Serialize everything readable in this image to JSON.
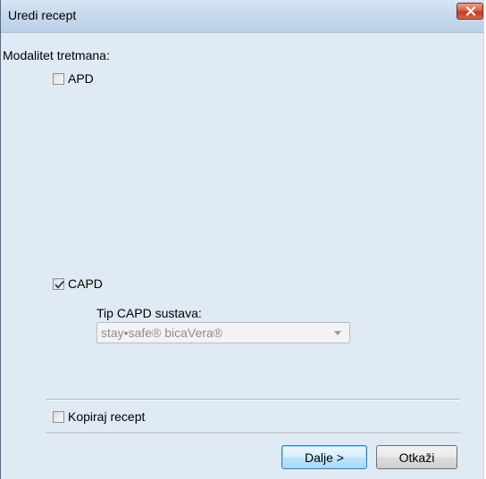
{
  "window": {
    "title": "Uredi recept"
  },
  "treatment": {
    "group_label": "Modalitet tretmana:",
    "apd": {
      "label": "APD",
      "checked": false
    },
    "capd": {
      "label": "CAPD",
      "checked": true,
      "system_type_label": "Tip CAPD sustava:",
      "system_type_value": "stay•safe® bicaVera®"
    }
  },
  "copy_recipe": {
    "label": "Kopiraj recept",
    "checked": false
  },
  "buttons": {
    "next_label": "Dalje >",
    "cancel_label": "Otkaži"
  },
  "icons": {
    "close": "close-icon",
    "check": "checkmark-icon",
    "dropdown": "chevron-down-icon"
  },
  "colors": {
    "dialog_background": "#dfeaf5",
    "close_button": "#c13b22",
    "default_button_border": "#3c7fb1"
  }
}
